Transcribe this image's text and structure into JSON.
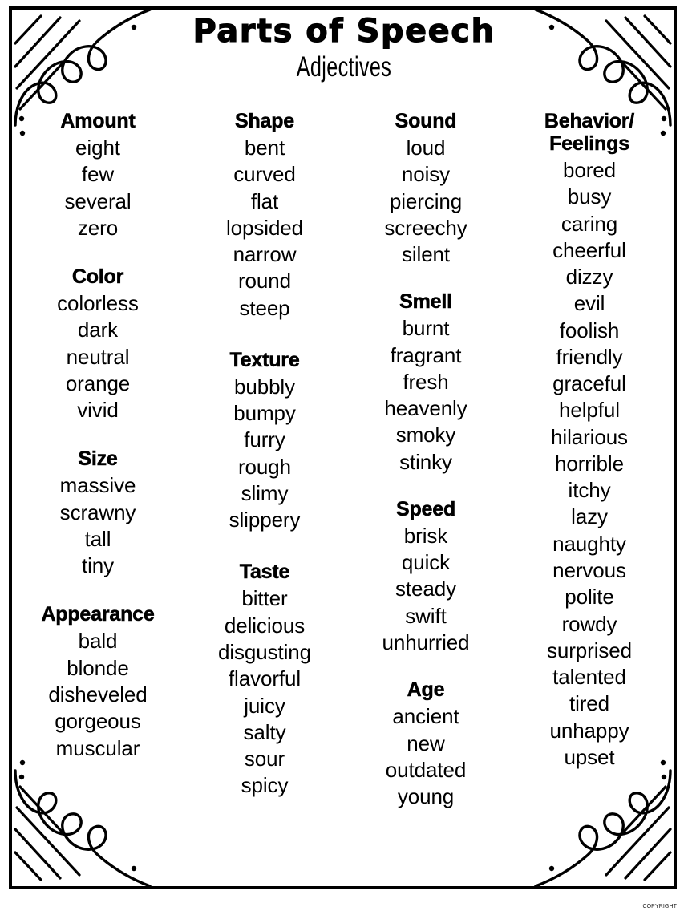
{
  "poster": {
    "title": "Parts of Speech",
    "subtitle": "Adjectives",
    "footer_credit": "COPYRIGHT"
  },
  "columns": [
    {
      "id": "column-1",
      "groups": [
        {
          "heading": "Amount",
          "words": [
            "eight",
            "few",
            "several",
            "zero"
          ]
        },
        {
          "heading": "Color",
          "words": [
            "colorless",
            "dark",
            "neutral",
            "orange",
            "vivid"
          ]
        },
        {
          "heading": "Size",
          "words": [
            "massive",
            "scrawny",
            "tall",
            "tiny"
          ]
        },
        {
          "heading": "Appearance",
          "words": [
            "bald",
            "blonde",
            "disheveled",
            "gorgeous",
            "muscular"
          ]
        }
      ]
    },
    {
      "id": "column-2",
      "groups": [
        {
          "heading": "Shape",
          "words": [
            "bent",
            "curved",
            "flat",
            "lopsided",
            "narrow",
            "round",
            "steep"
          ]
        },
        {
          "heading": "Texture",
          "words": [
            "bubbly",
            "bumpy",
            "furry",
            "rough",
            "slimy",
            "slippery"
          ]
        },
        {
          "heading": "Taste",
          "words": [
            "bitter",
            "delicious",
            "disgusting",
            "flavorful",
            "juicy",
            "salty",
            "sour",
            "spicy"
          ]
        }
      ]
    },
    {
      "id": "column-3",
      "groups": [
        {
          "heading": "Sound",
          "words": [
            "loud",
            "noisy",
            "piercing",
            "screechy",
            "silent"
          ]
        },
        {
          "heading": "Smell",
          "words": [
            "burnt",
            "fragrant",
            "fresh",
            "heavenly",
            "smoky",
            "stinky"
          ]
        },
        {
          "heading": "Speed",
          "words": [
            "brisk",
            "quick",
            "steady",
            "swift",
            "unhurried"
          ]
        },
        {
          "heading": "Age",
          "words": [
            "ancient",
            "new",
            "outdated",
            "young"
          ]
        }
      ]
    },
    {
      "id": "column-4",
      "groups": [
        {
          "heading": "Behavior/ Feelings",
          "heading_lines": [
            "Behavior/",
            "Feelings"
          ],
          "words": [
            "bored",
            "busy",
            "caring",
            "cheerful",
            "dizzy",
            "evil",
            "foolish",
            "friendly",
            "graceful",
            "helpful",
            "hilarious",
            "horrible",
            "itchy",
            "lazy",
            "naughty",
            "nervous",
            "polite",
            "rowdy",
            "surprised",
            "talented",
            "tired",
            "unhappy",
            "upset"
          ]
        }
      ]
    }
  ],
  "decorations": {
    "corner_doodle": "swirl-and-hatch-corner-doodle",
    "dots": "scattered-dots"
  },
  "colors": {
    "ink": "#000000",
    "paper": "#ffffff"
  }
}
